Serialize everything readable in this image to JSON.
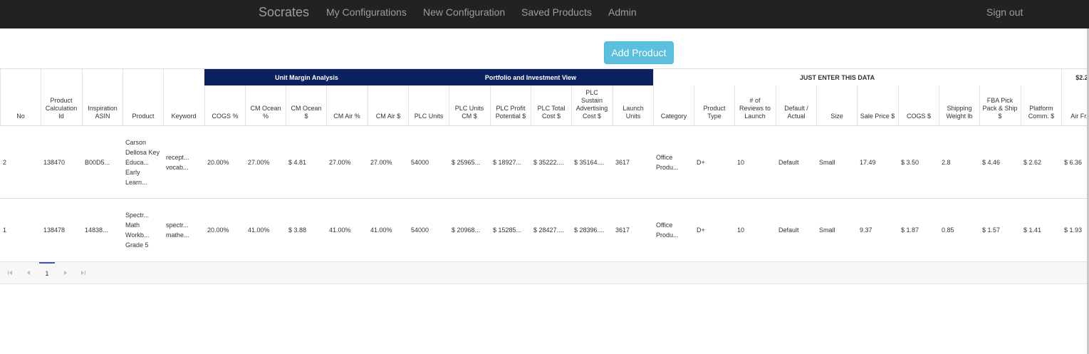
{
  "nav": {
    "brand": "Socrates",
    "links": [
      "My Configurations",
      "New Configuration",
      "Saved Products",
      "Admin"
    ],
    "signout": "Sign out"
  },
  "toolbar": {
    "add_product": "Add Product"
  },
  "groups": {
    "unit_margin": "Unit Margin Analysis",
    "portfolio": "Portfolio and Investment View",
    "just_enter": "JUST ENTER THIS DATA",
    "cut_off": "$2.2"
  },
  "columns": [
    "No",
    "Product Calculation Id",
    "Inspiration ASIN",
    "Product",
    "Keyword",
    "COGS %",
    "CM Ocean %",
    "CM Ocean $",
    "CM Air %",
    "CM Air $",
    "PLC Units",
    "PLC Units CM $",
    "PLC Profit Potential $",
    "PLC Total Cost $",
    "PLC Sustain Advertising Cost $",
    "Launch Units",
    "Category",
    "Product Type",
    "# of Reviews to Launch",
    "Default / Actual",
    "Size",
    "Sale Price $",
    "COGS $",
    "Shipping Weight lb",
    "FBA Pick Pack & Ship $",
    "Platform Comm. $",
    "Air Fr. $"
  ],
  "rows": [
    [
      "2",
      "138470",
      "B00D5...",
      "Carson Dellosa Key Educa... Early Learn...",
      "recept... vocab...",
      "20.00%",
      "27.00%",
      "$ 4.81",
      "27.00%",
      "27.00%",
      "54000",
      "$ 25965...",
      "$ 18927...",
      "$ 35222....",
      "$ 35164....",
      "3617",
      "Office Produ...",
      "D+",
      "10",
      "Default",
      "Small",
      "17.49",
      "$ 3.50",
      "2.8",
      "$ 4.46",
      "$ 2.62",
      "$ 6.36"
    ],
    [
      "1",
      "138478",
      "14838...",
      "Spectr... Math Workb... Grade 5",
      "spectr... mathe...",
      "20.00%",
      "41.00%",
      "$ 3.88",
      "41.00%",
      "41.00%",
      "54000",
      "$ 20968...",
      "$ 15285...",
      "$ 28427....",
      "$ 28396....",
      "3617",
      "Office Produ...",
      "D+",
      "10",
      "Default",
      "Small",
      "9.37",
      "$ 1.87",
      "0.85",
      "$ 1.57",
      "$ 1.41",
      "$ 1.93"
    ]
  ],
  "pager": {
    "first_icon": "first-page-icon",
    "prev_icon": "prev-page-icon",
    "page": "1",
    "next_icon": "next-page-icon",
    "last_icon": "last-page-icon"
  }
}
